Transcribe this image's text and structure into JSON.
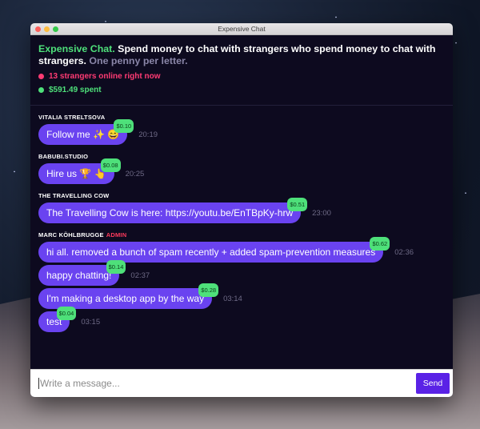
{
  "window": {
    "title": "Expensive Chat"
  },
  "header": {
    "brand": "Expensive Chat.",
    "tagline": " Spend money to chat with strangers who spend money to chat with strangers.",
    "pricing": " One penny per letter.",
    "online": "13 strangers online right now",
    "spent": "$591.49 spent"
  },
  "colors": {
    "brand_green": "#4ee07a",
    "online_red": "#ff3b73",
    "bubble_purple": "#6a43f0",
    "send_purple": "#5a22e6",
    "background": "#0d0a1f"
  },
  "groups": [
    {
      "author": "VITALIA STRELTSOVA",
      "role": "",
      "messages": [
        {
          "text": "Follow me ✨ 😄",
          "price": "$0.10",
          "time": "20:19"
        }
      ]
    },
    {
      "author": "BABUBI.STUDIO",
      "role": "",
      "messages": [
        {
          "text": "Hire us 🏆 👆",
          "price": "$0.08",
          "time": "20:25"
        }
      ]
    },
    {
      "author": "THE TRAVELLING COW",
      "role": "",
      "messages": [
        {
          "text": "The Travelling Cow is here: https://youtu.be/EnTBpKy-hrw",
          "price": "$0.51",
          "time": "23:00"
        }
      ]
    },
    {
      "author": "MARC KÖHLBRUGGE",
      "role": "ADMIN",
      "messages": [
        {
          "text": "hi all. removed a bunch of spam recently + added spam-prevention measures",
          "price": "$0.62",
          "time": "02:36"
        },
        {
          "text": "happy chatting!",
          "price": "$0.14",
          "time": "02:37"
        },
        {
          "text": "I'm making a desktop app by the way",
          "price": "$0.28",
          "time": "03:14"
        },
        {
          "text": "test",
          "price": "$0.04",
          "time": "03:15"
        }
      ]
    }
  ],
  "composer": {
    "placeholder": "Write a message...",
    "send_label": "Send"
  }
}
